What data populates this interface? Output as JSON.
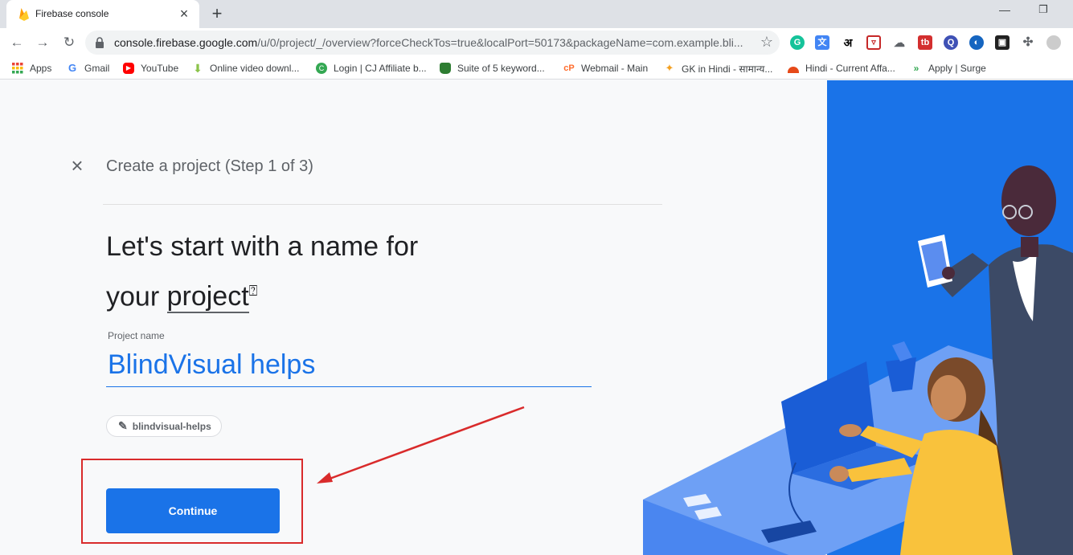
{
  "browser": {
    "tab_title": "Firebase console",
    "url_host": "console.firebase.google.com",
    "url_path": "/u/0/project/_/overview?forceCheckTos=true&localPort=50173&packageName=com.example.bli..."
  },
  "bookmarks": [
    {
      "label": "Apps",
      "icon": "apps-grid-icon",
      "color": "#ea4335"
    },
    {
      "label": "Gmail",
      "icon": "google-icon",
      "color": "#4285f4"
    },
    {
      "label": "YouTube",
      "icon": "youtube-icon",
      "color": "#ff0000"
    },
    {
      "label": "Online video downl...",
      "icon": "download-arrow-icon",
      "color": "#8bc34a"
    },
    {
      "label": "Login | CJ Affiliate b...",
      "icon": "cj-icon",
      "color": "#34a853"
    },
    {
      "label": "Suite of 5 keyword...",
      "icon": "database-icon",
      "color": "#2e7d32"
    },
    {
      "label": "Webmail - Main",
      "icon": "cpanel-icon",
      "color": "#ff6c2c"
    },
    {
      "label": "GK in Hindi - सामान्य...",
      "icon": "person-icon",
      "color": "#f4a020"
    },
    {
      "label": "Hindi - Current Affa...",
      "icon": "sunrise-icon",
      "color": "#e64a19"
    },
    {
      "label": "Apply | Surge",
      "icon": "chevrons-icon",
      "color": "#34a853"
    }
  ],
  "page": {
    "step_title": "Create a project (Step 1 of 3)",
    "heading_line1": "Let's start with a name for",
    "heading_line2_prefix": "your",
    "heading_line2_link": "project",
    "help_glyph": "?",
    "field_label": "Project name",
    "project_name": "BlindVisual helps",
    "project_id": "blindvisual-helps",
    "continue_label": "Continue"
  },
  "colors": {
    "accent": "#1a73e8",
    "annotation_red": "#d92b2b",
    "illustration_bg": "#1a73e8"
  }
}
